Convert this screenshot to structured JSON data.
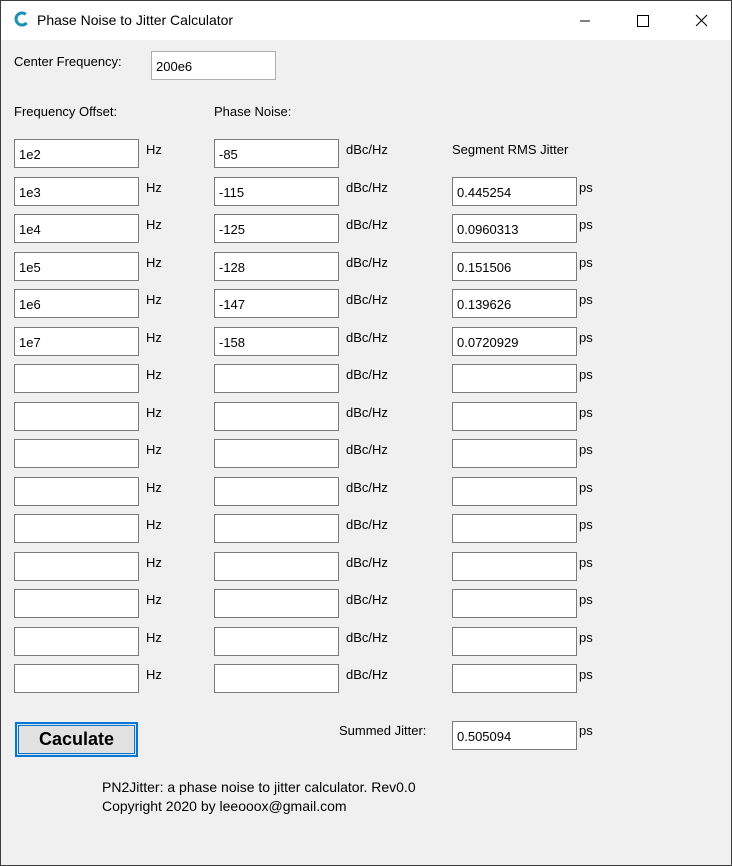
{
  "window": {
    "title": "Phase Noise to Jitter Calculator"
  },
  "center_frequency": {
    "label": "Center Frequency:",
    "value": "200e6"
  },
  "headers": {
    "frequency_offset": "Frequency Offset:",
    "phase_noise": "Phase Noise:",
    "segment_jitter": "Segment RMS Jitter"
  },
  "units": {
    "freq": "Hz",
    "pn": "dBc/Hz",
    "jitter": "ps"
  },
  "rows": [
    {
      "freq": "1e2",
      "pn": "-85",
      "jitter": null
    },
    {
      "freq": "1e3",
      "pn": "-115",
      "jitter": "0.445254"
    },
    {
      "freq": "1e4",
      "pn": "-125",
      "jitter": "0.0960313"
    },
    {
      "freq": "1e5",
      "pn": "-128",
      "jitter": "0.151506"
    },
    {
      "freq": "1e6",
      "pn": "-147",
      "jitter": "0.139626"
    },
    {
      "freq": "1e7",
      "pn": "-158",
      "jitter": "0.0720929"
    },
    {
      "freq": "",
      "pn": "",
      "jitter": ""
    },
    {
      "freq": "",
      "pn": "",
      "jitter": ""
    },
    {
      "freq": "",
      "pn": "",
      "jitter": ""
    },
    {
      "freq": "",
      "pn": "",
      "jitter": ""
    },
    {
      "freq": "",
      "pn": "",
      "jitter": ""
    },
    {
      "freq": "",
      "pn": "",
      "jitter": ""
    },
    {
      "freq": "",
      "pn": "",
      "jitter": ""
    },
    {
      "freq": "",
      "pn": "",
      "jitter": ""
    },
    {
      "freq": "",
      "pn": "",
      "jitter": ""
    }
  ],
  "calculate_button": "Caculate",
  "summed_jitter": {
    "label": "Summed Jitter:",
    "value": "0.505094"
  },
  "footer": {
    "line1": "PN2Jitter: a phase noise to jitter calculator. Rev0.0",
    "line2": "Copyright 2020 by leeooox@gmail.com"
  },
  "colors": {
    "accent": "#0078d7",
    "icon": "#1e90b4"
  }
}
